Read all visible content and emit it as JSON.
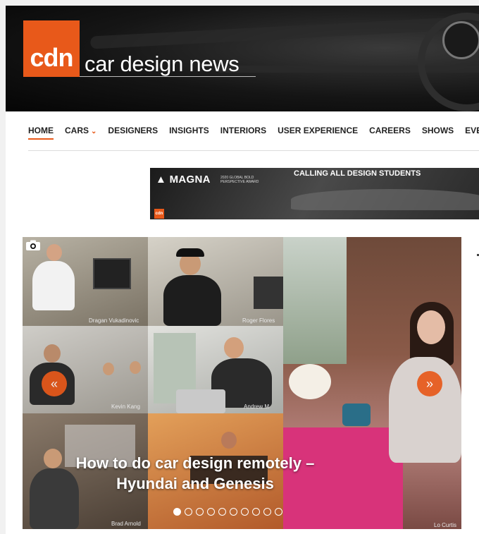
{
  "header": {
    "logo_mark": "cdn",
    "logo_text": "car design news"
  },
  "nav": {
    "items": [
      {
        "label": "HOME",
        "active": true
      },
      {
        "label": "CARS",
        "dropdown": true
      },
      {
        "label": "DESIGNERS"
      },
      {
        "label": "INSIGHTS"
      },
      {
        "label": "INTERIORS"
      },
      {
        "label": "USER EXPERIENCE"
      },
      {
        "label": "CAREERS"
      },
      {
        "label": "SHOWS"
      },
      {
        "label": "EVE"
      }
    ]
  },
  "banner": {
    "brand": "MAGNA",
    "award": "2020 GLOBAL BOLD PERSPECTIVE AWARD",
    "headline": "CALLING ALL DESIGN STUDENTS",
    "mini_logo": "cdn"
  },
  "slider": {
    "caption_line1": "How to do car design remotely –",
    "caption_line2": "Hyundai and Genesis",
    "names": [
      "Dragan Vukadinovic",
      "Roger Flores",
      "Kevin Kang",
      "Andrew M",
      "Brad Arnold",
      "Lo Curtis"
    ],
    "prev_icon": "«",
    "next_icon": "»",
    "dot_count": 10,
    "active_dot": 0
  },
  "colors": {
    "accent": "#e8591a"
  }
}
